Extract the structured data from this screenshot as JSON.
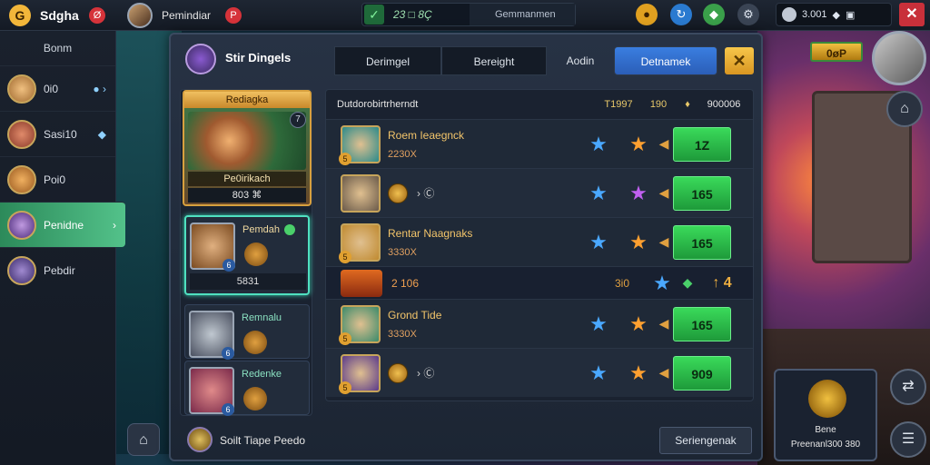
{
  "topbar": {
    "logo_glyph": "G",
    "app_title": "Sdgha",
    "app_badge": "Ø",
    "player_name": "Pemindiar",
    "player_badge": "P",
    "search_value": "23 □ 8Ç",
    "search_placeholder": "Gemmanmen",
    "currency_value": "3.001",
    "close_label": "✕"
  },
  "sidebar": {
    "header": "Bonm",
    "items": [
      {
        "label": "0i0",
        "extra": "● ›",
        "color": "#e0b060"
      },
      {
        "label": "Sasi10",
        "extra": "◆",
        "color": "#d06a4a"
      },
      {
        "label": "Poi0",
        "extra": "",
        "color": "#e0a040"
      },
      {
        "label": "Penidne",
        "extra": "›",
        "color": "#b07ad0"
      },
      {
        "label": "Pebdir",
        "extra": "",
        "color": "#8a70c0"
      }
    ]
  },
  "dialog": {
    "title": "Stir Dingels",
    "tabs": [
      "Derimgel",
      "Bereight",
      "Aodin",
      "Detnamek"
    ],
    "close_glyph": "✕",
    "feature": {
      "label": "Rediagka",
      "name": "Pe0irikach",
      "score": "803 ⌘",
      "badge": "7"
    },
    "heroes": [
      {
        "name": "Pemdah",
        "bar": "5831",
        "lvl": "6"
      },
      {
        "name": "Remnalu",
        "bar": "",
        "lvl": "6"
      },
      {
        "name": "Redenke",
        "bar": "",
        "lvl": "6"
      }
    ],
    "table": {
      "header": {
        "main": "Dutdorobirtrherndt",
        "c1": "T1997",
        "c2": "190",
        "c3": "♦",
        "c4": "900006"
      },
      "rows": [
        {
          "type": "hero",
          "name": "Roem Ieaegnck",
          "sub": "2230X",
          "star1": "blue",
          "star2": "orange",
          "score": "1Z",
          "avatar": "#2a8a8a",
          "lv": "5"
        },
        {
          "type": "coins",
          "coin_text": "› Ⓒ",
          "star1": "blue",
          "star2": "purple",
          "score": "165",
          "avatar": "#6a5a4a",
          "lv": ""
        },
        {
          "type": "hero",
          "name": "Rentar Naagnaks",
          "sub": "3330X",
          "star1": "blue",
          "star2": "orange",
          "score": "165",
          "avatar": "#c08a30",
          "lv": "5"
        },
        {
          "type": "short",
          "val": "2 106",
          "num": "3i0",
          "arrow": "↑ 4"
        },
        {
          "type": "hero",
          "name": "Grond Tide",
          "sub": "3330X",
          "star1": "blue",
          "star2": "orange",
          "score": "165",
          "avatar": "#3a8a6a",
          "lv": "5"
        },
        {
          "type": "coins",
          "coin_text": "› Ⓒ",
          "star1": "blue",
          "star2": "orange",
          "score": "909",
          "avatar": "#5a3a8a",
          "lv": "5"
        }
      ]
    },
    "footer_text": "Soilt Tiape Peedo",
    "footer_button": "Seriengenak"
  },
  "hud": {
    "tag": "0øP",
    "panel_line1": "Bene",
    "panel_line2": "Preenanl300 380"
  }
}
